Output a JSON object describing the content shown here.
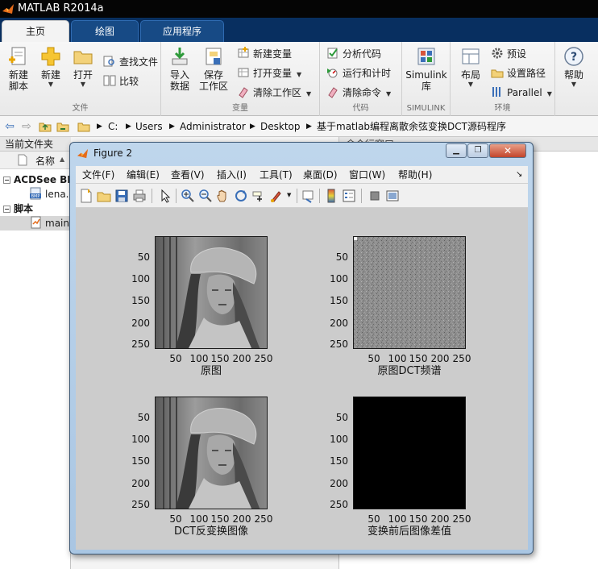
{
  "app": {
    "title": "MATLAB R2014a",
    "accent": "#082f60"
  },
  "tabs": [
    {
      "label": "主页",
      "active": true
    },
    {
      "label": "绘图",
      "active": false
    },
    {
      "label": "应用程序",
      "active": false
    }
  ],
  "ribbon": {
    "file": {
      "section": "文件",
      "new_script": "新建\n脚本",
      "new": "新建",
      "open": "打开",
      "find_files": "查找文件",
      "compare": "比较"
    },
    "variable": {
      "section": "变量",
      "import": "导入\n数据",
      "save_ws": "保存\n工作区",
      "new_var": "新建变量",
      "open_var": "打开变量",
      "clear_ws": "清除工作区"
    },
    "code": {
      "section": "代码",
      "analyze": "分析代码",
      "run_time": "运行和计时",
      "clear_cmd": "清除命令"
    },
    "simulink": {
      "section": "SIMULINK",
      "lib": "Simulink\n库"
    },
    "env": {
      "section": "环境",
      "layout": "布局",
      "prefs": "预设",
      "set_path": "设置路径",
      "parallel": "Parallel"
    },
    "help": "帮助"
  },
  "address": {
    "crumbs": [
      "C:",
      "Users",
      "Administrator",
      "Desktop",
      "基于matlab编程离散余弦变换DCT源码程序"
    ]
  },
  "left_panel": {
    "title": "当前文件夹",
    "col_name": "名称",
    "col_sort": "▲",
    "group1": "ACDSee BM",
    "file1": "lena.",
    "group2": "脚本",
    "file2": "main"
  },
  "right_panel": {
    "title": "命令行窗口"
  },
  "figure": {
    "title": "Figure 2",
    "menus": [
      "文件(F)",
      "编辑(E)",
      "查看(V)",
      "插入(I)",
      "工具(T)",
      "桌面(D)",
      "窗口(W)",
      "帮助(H)"
    ],
    "toolbar_icons": [
      "new-figure-icon",
      "open-file-icon",
      "save-figure-icon",
      "print-figure-icon",
      "edit-plot-arrow-icon",
      "zoom-in-icon",
      "zoom-out-icon",
      "pan-hand-icon",
      "rotate-3d-icon",
      "data-cursor-icon",
      "brush-icon",
      "link-plot-icon",
      "insert-colorbar-icon",
      "insert-legend-icon",
      "hide-plot-tools-icon",
      "show-plot-tools-icon"
    ]
  },
  "chart_data": [
    {
      "type": "heatmap",
      "title": "原图",
      "yticks": [
        "50",
        "100",
        "150",
        "200",
        "250"
      ],
      "xticks": [
        "50",
        "100",
        "150",
        "200",
        "250"
      ],
      "xlim": [
        0.5,
        256.5
      ],
      "ylim": [
        0.5,
        256.5
      ],
      "content": "grayscale image",
      "colormap": "gray"
    },
    {
      "type": "heatmap",
      "title": "原图DCT频谱",
      "yticks": [
        "50",
        "100",
        "150",
        "200",
        "250"
      ],
      "xticks": [
        "50",
        "100",
        "150",
        "200",
        "250"
      ],
      "xlim": [
        0.5,
        256.5
      ],
      "ylim": [
        0.5,
        256.5
      ],
      "content": "noise-like gray spectrum",
      "colormap": "gray"
    },
    {
      "type": "heatmap",
      "title": "DCT反变换图像",
      "yticks": [
        "50",
        "100",
        "150",
        "200",
        "250"
      ],
      "xticks": [
        "50",
        "100",
        "150",
        "200",
        "250"
      ],
      "xlim": [
        0.5,
        256.5
      ],
      "ylim": [
        0.5,
        256.5
      ],
      "content": "grayscale image",
      "colormap": "gray"
    },
    {
      "type": "heatmap",
      "title": "变换前后图像差值",
      "yticks": [
        "50",
        "100",
        "150",
        "200",
        "250"
      ],
      "xticks": [
        "50",
        "100",
        "150",
        "200",
        "250"
      ],
      "xlim": [
        0.5,
        256.5
      ],
      "ylim": [
        0.5,
        256.5
      ],
      "content": "all black (zero difference)",
      "colormap": "gray",
      "fill": "#000000"
    }
  ]
}
